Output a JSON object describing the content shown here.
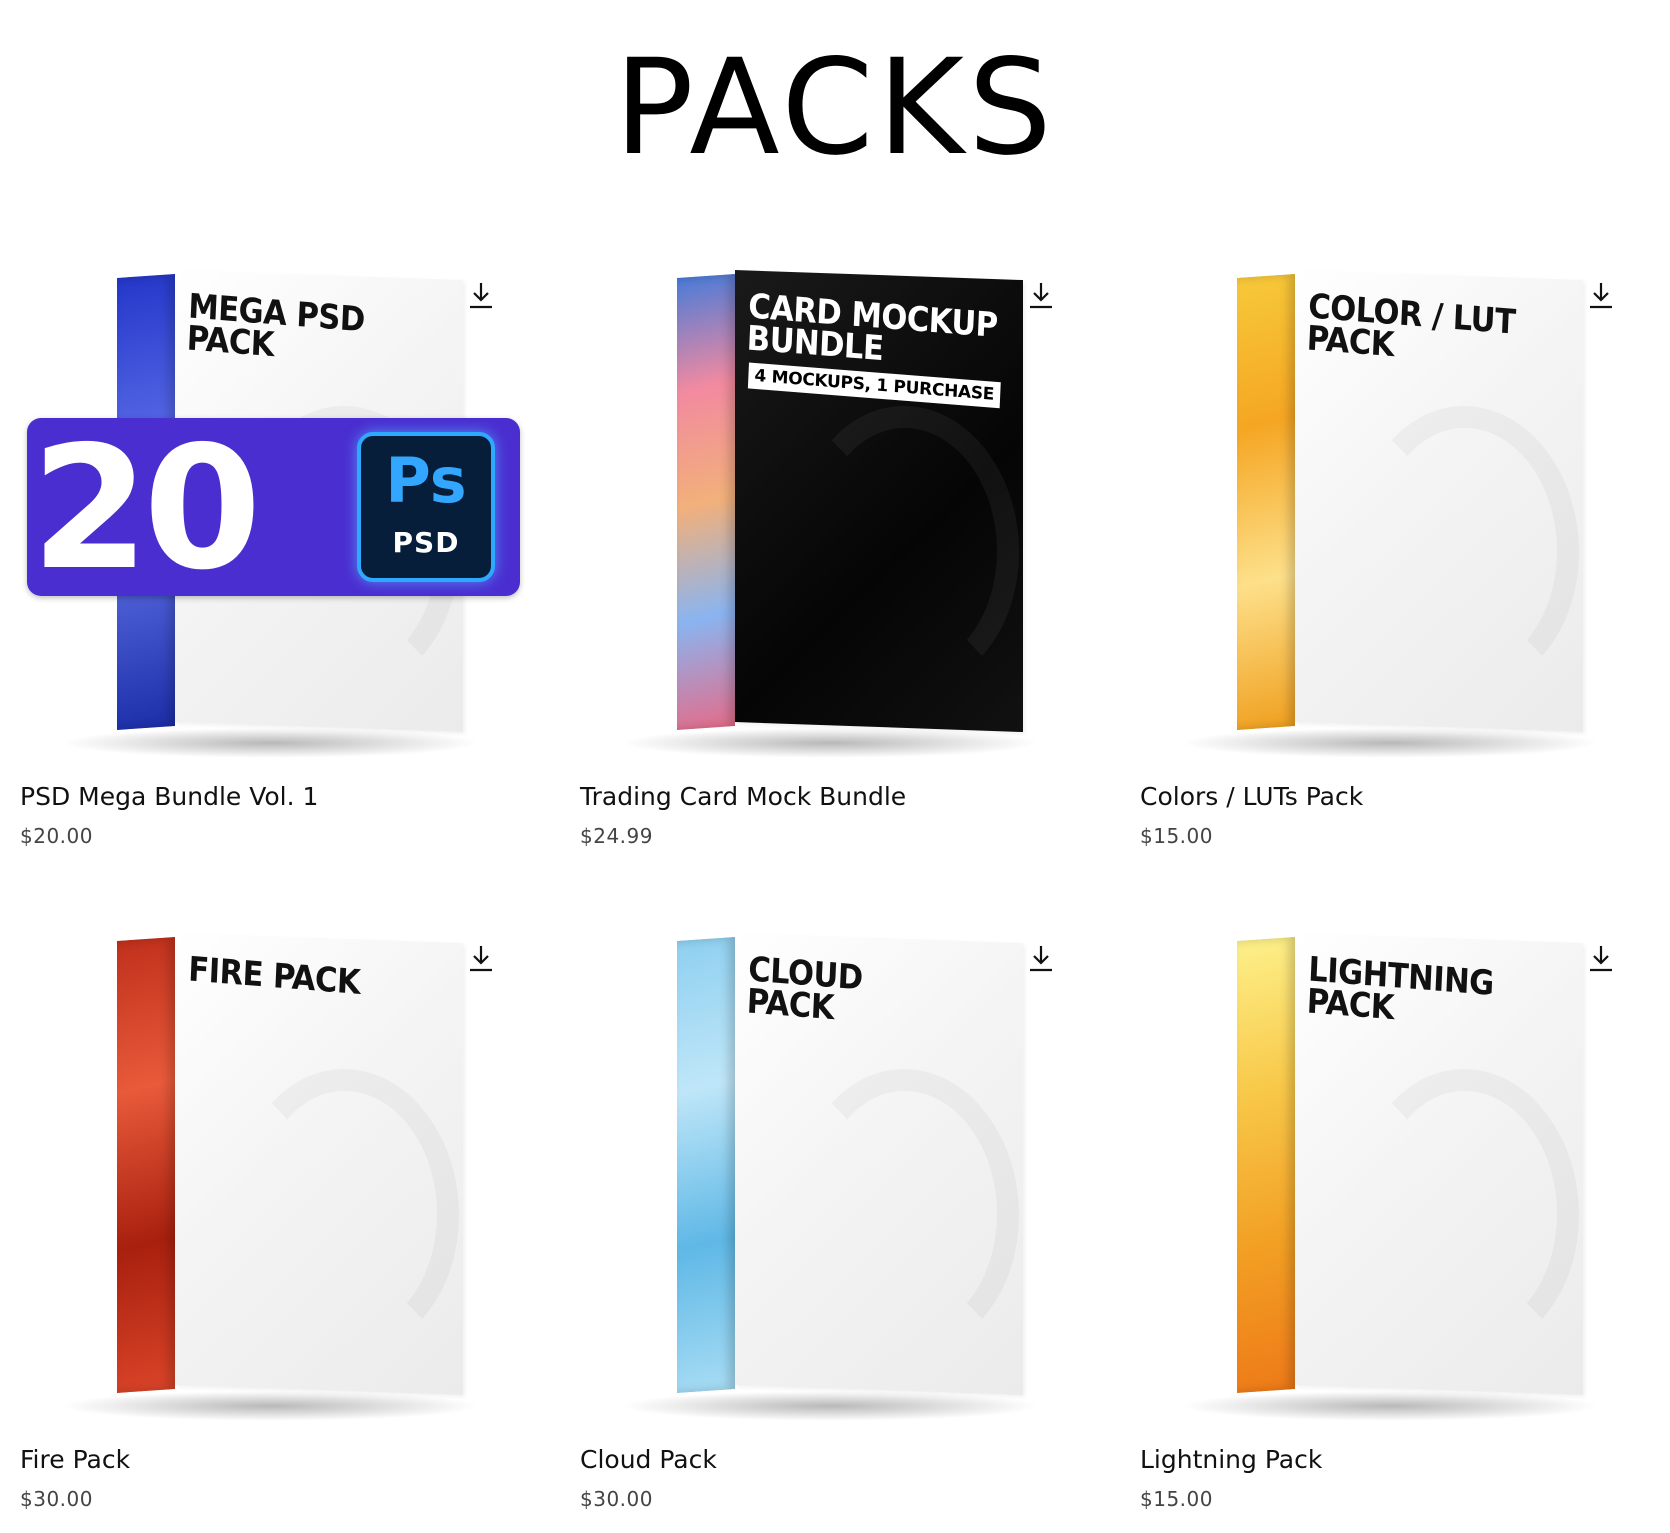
{
  "page": {
    "title": "PACKS"
  },
  "products": [
    {
      "name": "PSD Mega Bundle Vol. 1",
      "price": "$20.00",
      "box_label": "MEGA PSD\nPACK",
      "side_colors": [
        "#2437c9",
        "#6a7bf0",
        "#1c2ea8"
      ],
      "dark": false,
      "badge": {
        "number": "20",
        "app": "Ps",
        "format": "PSD",
        "color": "#4b2ed0"
      }
    },
    {
      "name": "Trading Card Mock Bundle",
      "price": "$24.99",
      "box_label": "CARD MOCKUP\nBUNDLE",
      "box_sub": "4 MOCKUPS, 1 PURCHASE",
      "side_colors": [
        "#4a7bd8",
        "#f28aa0",
        "#f2b07a",
        "#8ab4f0",
        "#e36d8a"
      ],
      "dark": true
    },
    {
      "name": "Colors / LUTs Pack",
      "price": "$15.00",
      "box_label": "COLOR / LUT\nPACK",
      "side_colors": [
        "#f7c93a",
        "#f5a623",
        "#fde08a",
        "#f0a020"
      ],
      "dark": false
    },
    {
      "name": "Fire Pack",
      "price": "$30.00",
      "box_label": "FIRE PACK",
      "side_colors": [
        "#c0301c",
        "#e85a3a",
        "#a8200e",
        "#d94428"
      ],
      "dark": false
    },
    {
      "name": "Cloud Pack",
      "price": "$30.00",
      "box_label": "CLOUD\nPACK",
      "side_colors": [
        "#8fd0f0",
        "#bfe6f8",
        "#5fb8e6",
        "#a8dcf4"
      ],
      "dark": false
    },
    {
      "name": "Lightning Pack",
      "price": "$15.00",
      "box_label": "LIGHTNING\nPACK",
      "side_colors": [
        "#fdf08a",
        "#f8c94a",
        "#f2a024",
        "#ee7a18"
      ],
      "dark": false
    }
  ],
  "icons": {
    "download": "download-icon"
  }
}
